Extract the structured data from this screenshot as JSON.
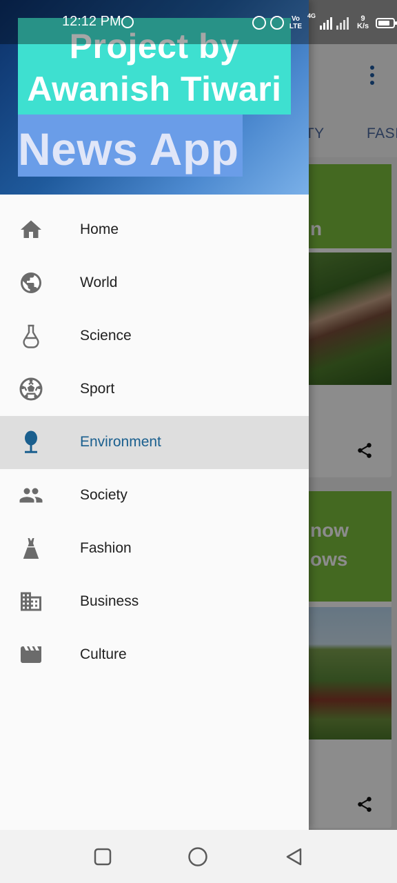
{
  "status_bar": {
    "time": "12:12 PM",
    "network_label": "Vo LTE",
    "speed_value": "9",
    "speed_unit": "K/s",
    "network_type": "4G"
  },
  "drawer": {
    "header": {
      "title": "Project by Awanish Tiwari",
      "subtitle": "News App",
      "banner_color": "#3ee0d0"
    },
    "items": [
      {
        "label": "Home",
        "icon": "home-icon",
        "active": false
      },
      {
        "label": "World",
        "icon": "globe-icon",
        "active": false
      },
      {
        "label": "Science",
        "icon": "flask-icon",
        "active": false
      },
      {
        "label": "Sport",
        "icon": "soccer-ball-icon",
        "active": false
      },
      {
        "label": "Environment",
        "icon": "tree-icon",
        "active": true
      },
      {
        "label": "Society",
        "icon": "people-icon",
        "active": false
      },
      {
        "label": "Fashion",
        "icon": "dress-icon",
        "active": false
      },
      {
        "label": "Business",
        "icon": "building-icon",
        "active": false
      },
      {
        "label": "Culture",
        "icon": "clapperboard-icon",
        "active": false
      }
    ],
    "active_color": "#1a5f8e"
  },
  "background": {
    "tabs": [
      "IETY",
      "FASI"
    ],
    "card_fragments": [
      "n",
      "now",
      "ows"
    ],
    "accent_green": "#7cbf3c"
  },
  "nav_bar": {
    "buttons": [
      "recents-icon",
      "home-circle-icon",
      "back-triangle-icon"
    ]
  }
}
